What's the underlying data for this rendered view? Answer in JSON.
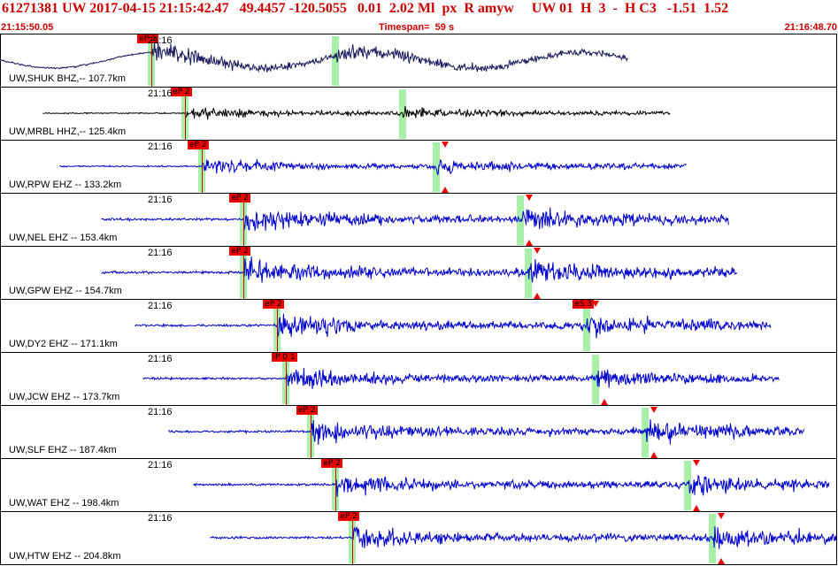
{
  "header": {
    "title": "61271381 UW 2017-04-15 21:15:42.47   49.4457 -120.5055   0.01  2.02 Ml  px  R amyw     UW 01  H  3  -  H C3   -1.51  1.52",
    "start_time": "21:15:50.05",
    "timespan": "Timespan=  59 s",
    "end_time": "21:16:48.70"
  },
  "colors": {
    "header_text": "#cc0000",
    "trace_blue": "#0000cc",
    "trace_navy": "#1a1a5e",
    "trace_black": "#000000",
    "pick_flag": "#ee0000",
    "green_window": "#a8f0a8"
  },
  "traces": [
    {
      "label": "UW,SHUK BHZ,-- 107.7km",
      "tick": "21:16",
      "pick": "eP 1",
      "color": "navy",
      "start": 0.0,
      "end": 0.75,
      "onset": 0.18,
      "s": 0.4,
      "amp": 0.35,
      "drift": true,
      "markers": []
    },
    {
      "label": "UW,MRBL HHZ,-- 125.4km",
      "tick": "21:16",
      "pick": "eP 2",
      "color": "black",
      "start": 0.05,
      "end": 0.8,
      "onset": 0.22,
      "s": 0.48,
      "amp": 0.22,
      "drift": false,
      "markers": []
    },
    {
      "label": "UW,RPW EHZ -- 133.2km",
      "tick": "21:16",
      "pick": "eP 2",
      "color": "blue",
      "start": 0.07,
      "end": 0.82,
      "onset": 0.24,
      "s": 0.52,
      "amp": 0.28,
      "drift": false,
      "markers": [
        "down",
        "up"
      ]
    },
    {
      "label": "UW,NEL EHZ -- 153.4km",
      "tick": "21:16",
      "pick": "eP 2",
      "color": "blue",
      "start": 0.12,
      "end": 0.87,
      "onset": 0.29,
      "s": 0.62,
      "amp": 0.45,
      "drift": false,
      "markers": [
        "down",
        "up"
      ]
    },
    {
      "label": "UW,GPW EHZ -- 154.7km",
      "tick": "21:16",
      "pick": "eP 2",
      "color": "blue",
      "start": 0.12,
      "end": 0.88,
      "onset": 0.29,
      "s": 0.63,
      "amp": 0.48,
      "drift": false,
      "markers": [
        "down",
        "up"
      ]
    },
    {
      "label": "UW,DY2 EHZ -- 171.1km",
      "tick": "21:16",
      "pick": "eP 2",
      "color": "blue",
      "start": 0.16,
      "end": 0.92,
      "onset": 0.33,
      "s": 0.7,
      "amp": 0.45,
      "drift": false,
      "markers": [
        "down"
      ],
      "spick": "eS 3"
    },
    {
      "label": "UW,JCW EHZ -- 173.7km",
      "tick": "21:16",
      "pick": "iP 0 1",
      "color": "blue",
      "start": 0.17,
      "end": 0.93,
      "onset": 0.34,
      "s": 0.71,
      "amp": 0.4,
      "drift": false,
      "markers": [
        "up"
      ]
    },
    {
      "label": "UW,SLF EHZ -- 187.4km",
      "tick": "21:16",
      "pick": "eP 2",
      "color": "blue",
      "start": 0.2,
      "end": 0.96,
      "onset": 0.37,
      "s": 0.77,
      "amp": 0.45,
      "drift": false,
      "markers": [
        "down",
        "up"
      ]
    },
    {
      "label": "UW,WAT EHZ -- 198.4km",
      "tick": "21:16",
      "pick": "eP 2",
      "color": "blue",
      "start": 0.23,
      "end": 0.99,
      "onset": 0.4,
      "s": 0.82,
      "amp": 0.42,
      "drift": false,
      "markers": [
        "down",
        "up"
      ]
    },
    {
      "label": "UW,HTW EHZ -- 204.8km",
      "tick": "21:16",
      "pick": "eP 2",
      "color": "blue",
      "start": 0.25,
      "end": 1.0,
      "onset": 0.42,
      "s": 0.85,
      "amp": 0.45,
      "drift": false,
      "markers": [
        "down",
        "up"
      ]
    }
  ]
}
